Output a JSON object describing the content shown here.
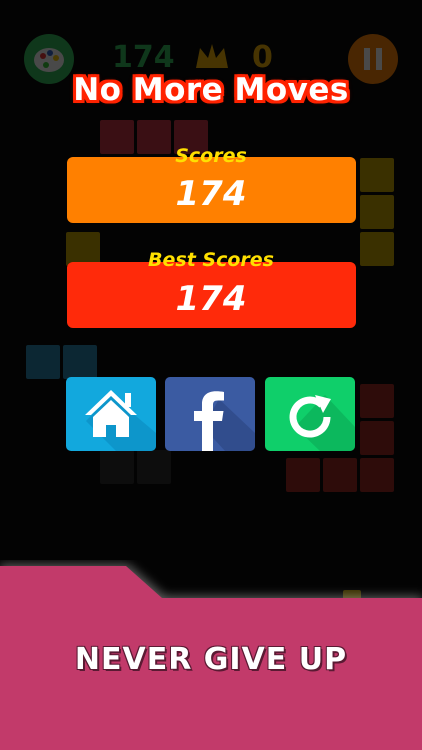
{
  "header": {
    "current_score": "174",
    "best_score": "0",
    "palette_icon": "palette-icon",
    "pause_icon": "pause-icon",
    "crown_icon": "crown-icon"
  },
  "game_over": {
    "title": "No More Moves",
    "score_label": "Scores",
    "score_value": "174",
    "best_label": "Best Scores",
    "best_value": "174"
  },
  "buttons": {
    "home": {
      "icon": "home-icon",
      "color": "#12a8dd"
    },
    "facebook": {
      "icon": "facebook-icon",
      "color": "#3b5ba2"
    },
    "restart": {
      "icon": "restart-icon",
      "color": "#0fcf6a"
    }
  },
  "banner": {
    "text": "NEVER GIVE UP",
    "color": "#c23a6a"
  },
  "colors": {
    "title_outline": "#ff2200",
    "score_box": "#ff8000",
    "best_box": "#ff2a0a",
    "label_yellow": "#ffe000"
  }
}
